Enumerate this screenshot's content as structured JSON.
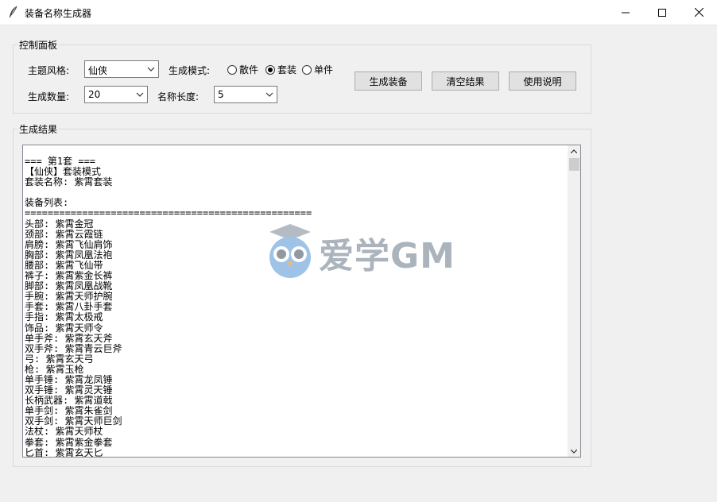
{
  "window": {
    "title": "装备名称生成器",
    "controls": {
      "minimize": "minimize",
      "maximize": "maximize",
      "close": "close"
    }
  },
  "control_panel": {
    "title": "控制面板",
    "theme_label": "主题风格:",
    "theme_value": "仙侠",
    "mode_label": "生成模式:",
    "modes": [
      {
        "label": "散件",
        "selected": false
      },
      {
        "label": "套装",
        "selected": true
      },
      {
        "label": "单件",
        "selected": false
      }
    ],
    "count_label": "生成数量:",
    "count_value": "20",
    "length_label": "名称长度:",
    "length_value": "5",
    "buttons": {
      "generate": "生成装备",
      "clear": "清空结果",
      "help": "使用说明"
    }
  },
  "results": {
    "title": "生成结果",
    "text": "=== 第1套 ===\n【仙侠】套装模式\n套装名称: 紫霄套装\n\n装备列表:\n==================================================\n头部: 紫霄金冠\n颈部: 紫霄云霞链\n肩膀: 紫霄飞仙肩饰\n胸部: 紫霄凤凰法袍\n腰部: 紫霄飞仙带\n裤子: 紫霄紫金长裤\n脚部: 紫霄凤凰战靴\n手腕: 紫霄天师护腕\n手套: 紫霄八卦手套\n手指: 紫霄太极戒\n饰品: 紫霄天师令\n单手斧: 紫霄玄天斧\n双手斧: 紫霄青云巨斧\n弓: 紫霄玄天弓\n枪: 紫霄玉枪\n单手锤: 紫霄龙凤锤\n双手锤: 紫霄灵天锤\n长柄武器: 紫霄道戟\n单手剑: 紫霄朱雀剑\n双手剑: 紫霄天师巨剑\n法杖: 紫霄天师杖\n拳套: 紫霄紫金拳套\n匕首: 紫霄玄天匕"
  },
  "watermark": {
    "text": "爱学GM"
  }
}
